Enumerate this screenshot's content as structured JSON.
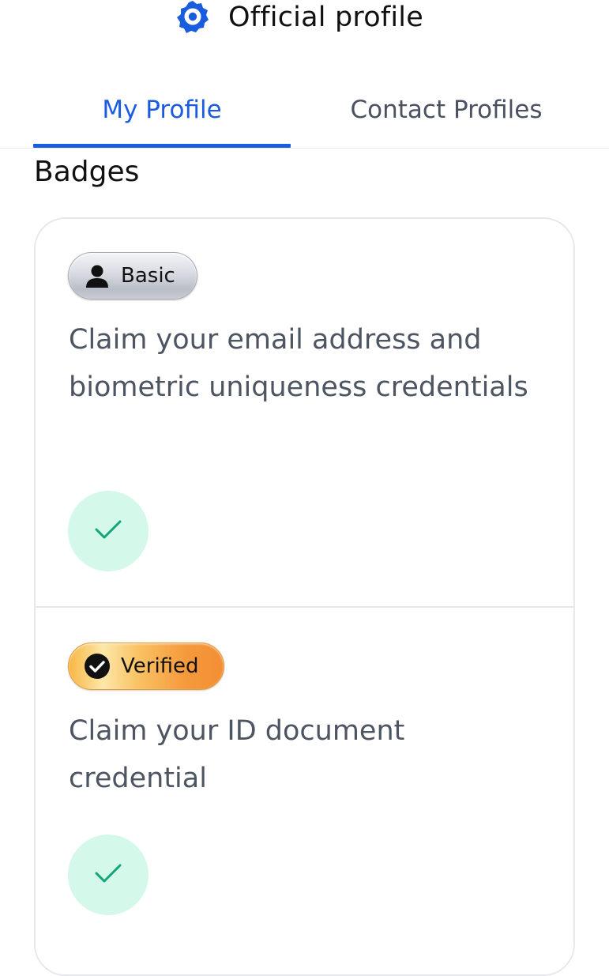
{
  "header": {
    "title": "Official profile",
    "logo_icon": "brand-logo-icon",
    "brand_color": "#1a5ce0"
  },
  "tabs": [
    {
      "label": "My Profile",
      "active": true
    },
    {
      "label": "Contact Profiles",
      "active": false
    }
  ],
  "section": {
    "title": "Badges"
  },
  "badges": [
    {
      "label": "Basic",
      "icon": "person-icon",
      "description": "Claim your email address and biometric uniqueness credentials",
      "status_icon": "checkmark-icon",
      "completed": true
    },
    {
      "label": "Verified",
      "icon": "check-seal-icon",
      "description": "Claim your ID document credential",
      "status_icon": "checkmark-icon",
      "completed": true
    }
  ],
  "colors": {
    "active_tab": "#1a5ce0",
    "check_bg": "#d4f8e9",
    "check_mark": "#12a57a"
  }
}
